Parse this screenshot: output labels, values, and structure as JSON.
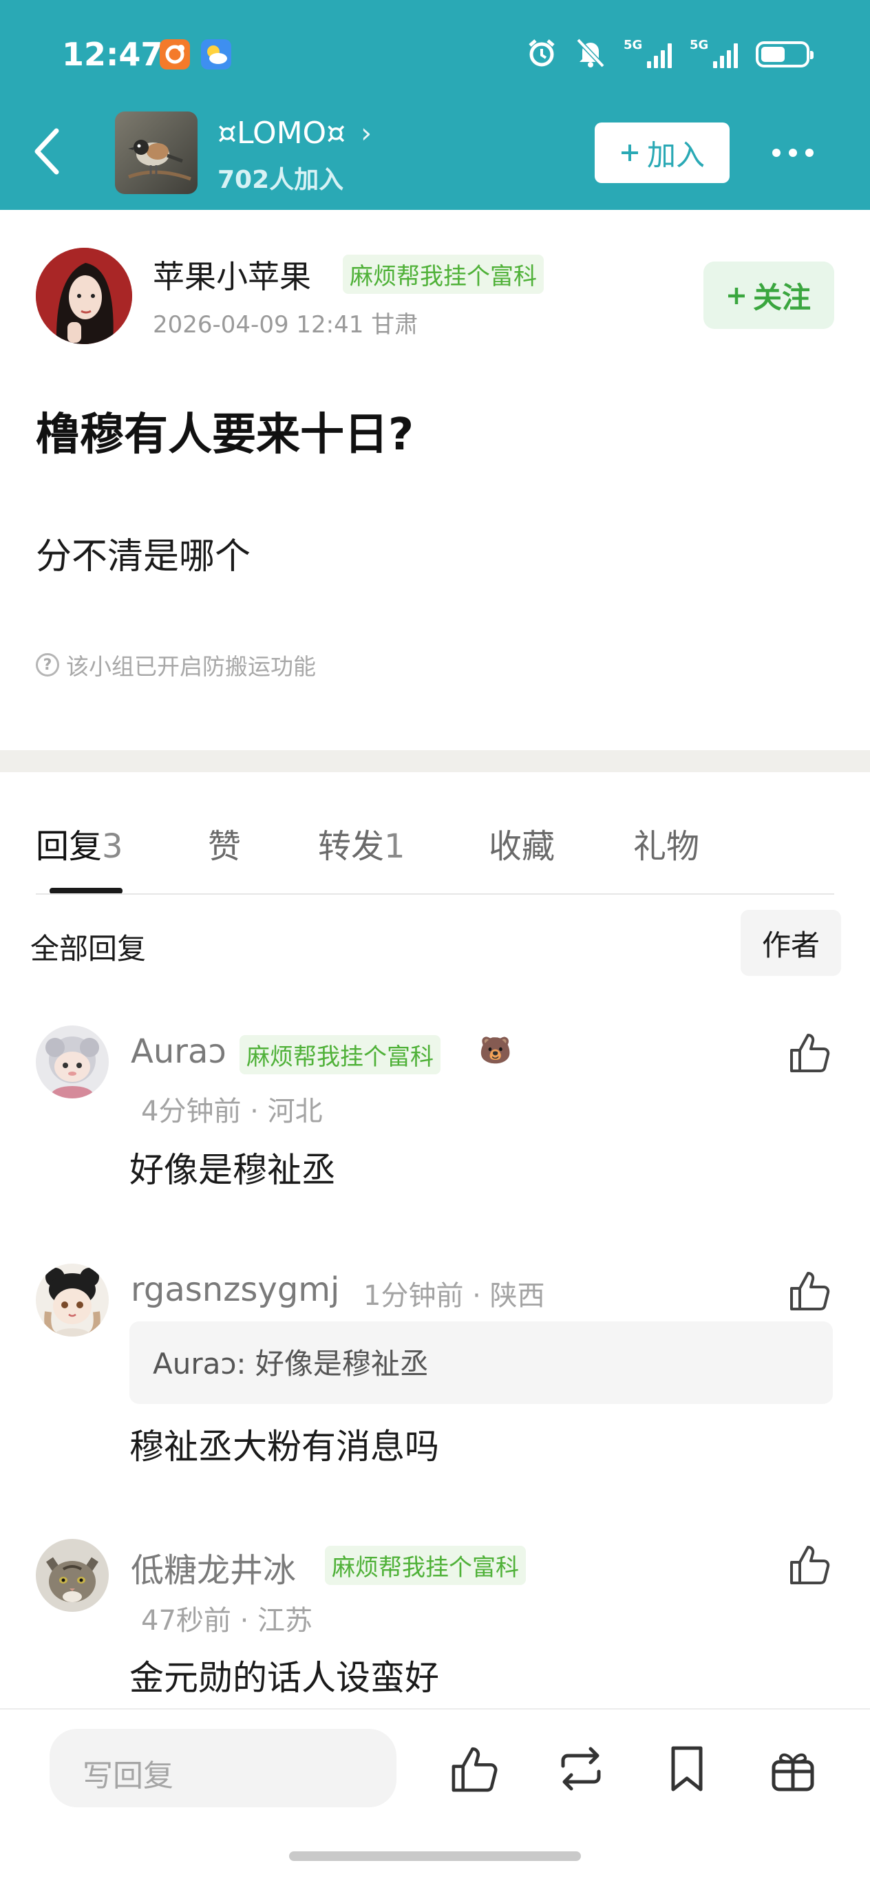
{
  "status_bar": {
    "time": "12:47",
    "app_icons": [
      "orange-app-icon",
      "weather-icon"
    ],
    "signal_1": "5G",
    "signal_2": "5G",
    "indicators": [
      "alarm-icon",
      "mute-icon",
      "battery-icon"
    ]
  },
  "header": {
    "group_name": "¤LOMO¤",
    "members": "702人加入",
    "join_label": "加入",
    "accent": "#2aa9b5"
  },
  "post": {
    "author": "苹果小苹果",
    "author_tag": "麻烦帮我挂个富科",
    "meta": "2026-04-09 12:41 甘肃",
    "follow_label": "关注",
    "title": "橹穆有人要来十日?",
    "body": "分不清是哪个",
    "notice": "该小组已开启防搬运功能"
  },
  "tabs": [
    {
      "label": "回复",
      "count": "3",
      "active": true
    },
    {
      "label": "赞",
      "count": ""
    },
    {
      "label": "转发",
      "count": "1"
    },
    {
      "label": "收藏",
      "count": ""
    },
    {
      "label": "礼物",
      "count": ""
    }
  ],
  "replies": {
    "all_label": "全部回复",
    "author_filter": "作者"
  },
  "comments": [
    {
      "name": "Auraↄ",
      "tag": "麻烦帮我挂个富科",
      "badge": "🐻",
      "meta": "4分钟前 · 河北",
      "text": "好像是穆祉丞"
    },
    {
      "name": "rgasnzsygmj",
      "meta": "1分钟前 · 陕西",
      "quote": "Auraↄ: 好像是穆祉丞",
      "text": "穆祉丞大粉有消息吗"
    },
    {
      "name": "低糖龙井冰",
      "tag": "麻烦帮我挂个富科",
      "meta": "47秒前 · 江苏",
      "text": "金元勋的话人设蛮好"
    }
  ],
  "bottom_bar": {
    "reply_placeholder": "写回复",
    "icons": [
      "like-icon",
      "repost-icon",
      "bookmark-icon",
      "gift-icon"
    ]
  }
}
